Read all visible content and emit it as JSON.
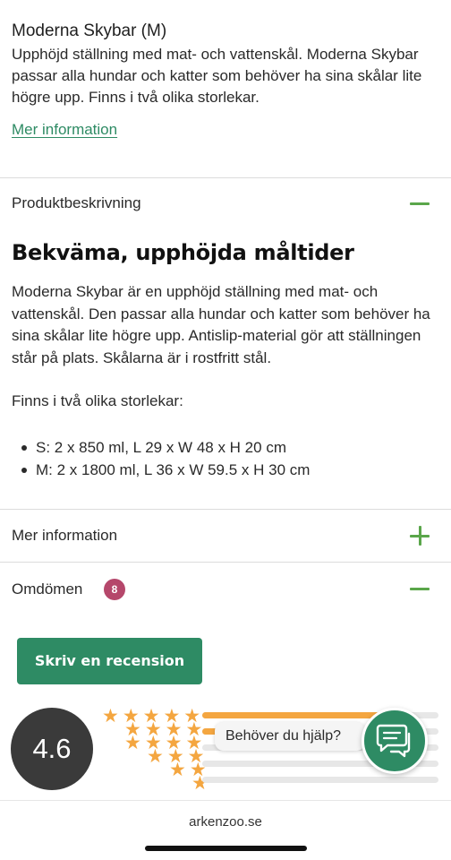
{
  "product": {
    "name": "Moderna Skybar (M)",
    "summary": "Upphöjd ställning med mat- och vattenskål. Moderna Skybar passar alla hundar och katter som behöver ha sina skålar lite högre upp. Finns i två olika storlekar.",
    "more_info_link": "Mer information"
  },
  "description_section": {
    "title": "Produktbeskrivning",
    "expanded": true,
    "heading": "Bekväma, upphöjda måltider",
    "body": "Moderna Skybar är en upphöjd ställning med mat- och vattenskål. Den passar alla hundar och katter som behöver ha sina skålar lite högre upp. Antislip-material gör att ställningen står på plats. Skålarna är i rostfritt stål.",
    "sizes_intro": "Finns i två olika storlekar:",
    "sizes": [
      "S: 2 x 850 ml, L 29 x W 48 x H 20 cm",
      "M: 2 x 1800 ml, L 36 x W 59.5 x H 30 cm"
    ]
  },
  "more_info_section": {
    "title": "Mer information",
    "expanded": false
  },
  "reviews_section": {
    "title": "Omdömen",
    "count": "8",
    "expanded": true,
    "write_review_label": "Skriv en recension",
    "average_rating": "4.6",
    "star_rows": [
      5,
      4,
      4,
      3,
      2,
      1
    ],
    "distribution": [
      0.75,
      0.25,
      0,
      0,
      0
    ]
  },
  "chat": {
    "help_text": "Behöver du hjälp?",
    "icon": "chat-bubbles-icon"
  },
  "browser": {
    "url": "arkenzoo.se"
  },
  "colors": {
    "accent_green": "#2e8b64",
    "toggle_green": "#5aa64a",
    "star_orange": "#f4a640",
    "badge_pink": "#b5476b",
    "rating_dark": "#3a3a3a"
  }
}
